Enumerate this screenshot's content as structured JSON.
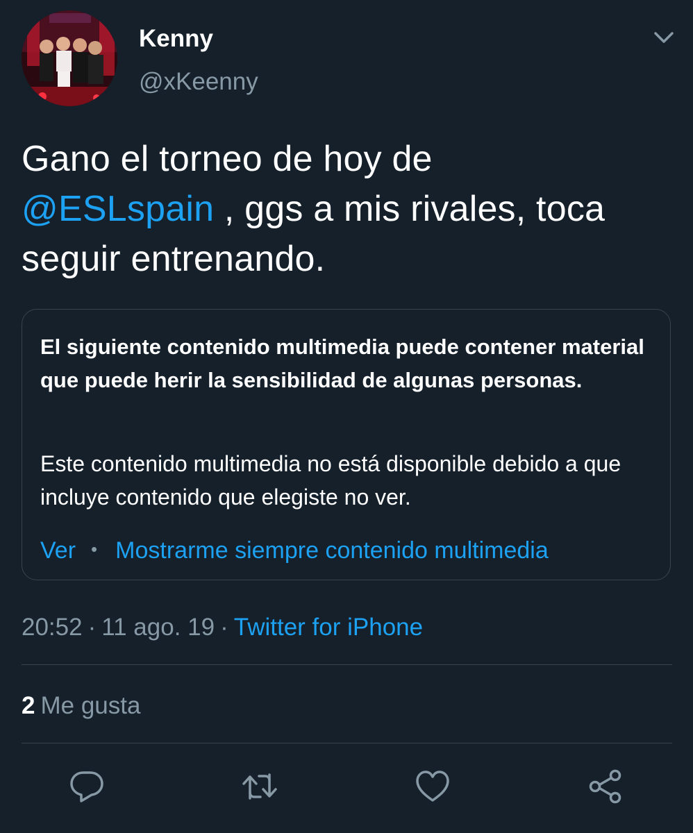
{
  "author": {
    "display_name": "Kenny",
    "handle": "@xKeenny"
  },
  "tweet": {
    "text_before": "Gano el torneo de hoy de ",
    "mention": "@ESLspain",
    "text_after": " , ggs a mis rivales, toca seguir entrenando."
  },
  "media_warning": {
    "title": "El siguiente contenido multimedia puede contener material que puede herir la sensibilidad de algunas personas.",
    "body": "Este contenido multimedia no está disponible debido a que incluye contenido que elegiste no ver.",
    "view_label": "Ver",
    "separator": "•",
    "always_show_label": "Mostrarme siempre contenido multimedia"
  },
  "meta": {
    "time": "20:52",
    "date": "11 ago. 19",
    "separator": "·",
    "source": "Twitter for iPhone"
  },
  "engagement": {
    "likes_count": "2",
    "likes_label": "Me gusta"
  },
  "actions": [
    {
      "icon": "reply-icon"
    },
    {
      "icon": "retweet-icon"
    },
    {
      "icon": "like-icon"
    },
    {
      "icon": "share-icon"
    }
  ],
  "colors": {
    "background": "#15202b",
    "text": "#ffffff",
    "secondary_text": "#8899a6",
    "accent": "#1da1f2",
    "border": "#38444d"
  }
}
